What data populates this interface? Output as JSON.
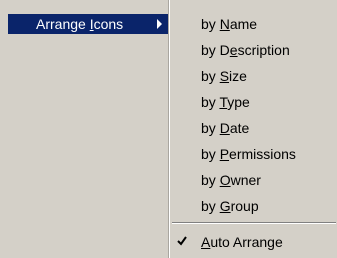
{
  "parent_menu": {
    "item": {
      "pre": "Arrange ",
      "accel": "I",
      "post": "cons"
    }
  },
  "submenu": {
    "items": [
      {
        "pre": "by ",
        "accel": "N",
        "post": "ame"
      },
      {
        "pre": "by D",
        "accel": "e",
        "post": "scription"
      },
      {
        "pre": "by ",
        "accel": "S",
        "post": "ize"
      },
      {
        "pre": "by ",
        "accel": "T",
        "post": "ype"
      },
      {
        "pre": "by ",
        "accel": "D",
        "post": "ate"
      },
      {
        "pre": "by ",
        "accel": "P",
        "post": "ermissions"
      },
      {
        "pre": "by ",
        "accel": "O",
        "post": "wner"
      },
      {
        "pre": "by ",
        "accel": "G",
        "post": "roup"
      }
    ],
    "auto_arrange": {
      "pre": "",
      "accel": "A",
      "post": "uto Arrange",
      "checked": true
    }
  },
  "colors": {
    "highlight": "#0a246a",
    "menu_bg": "#d4d0c8"
  },
  "icons": {
    "submenu_arrow": "chevron-right-icon",
    "check": "checkmark-icon"
  }
}
